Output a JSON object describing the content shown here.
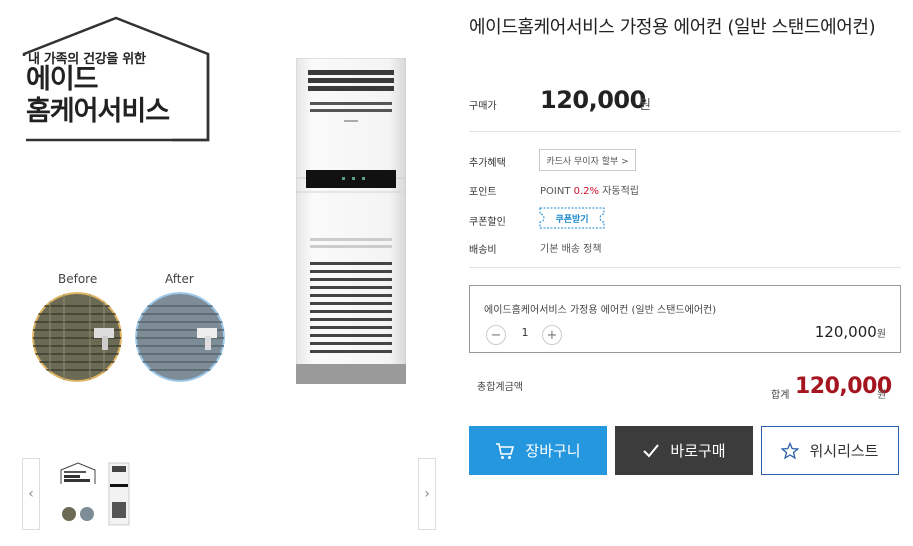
{
  "gallery": {
    "brand_line1": "내 가족의 건강을 위한",
    "brand_line2": "에이드",
    "brand_line3": "홈케어서비스",
    "before_label": "Before",
    "after_label": "After",
    "prev_icon": "chevron-left-icon",
    "next_icon": "chevron-right-icon"
  },
  "product": {
    "title": "에이드홈케어서비스 가정용 에어컨 (일반 스탠드에어컨)",
    "price_label": "구매가",
    "price": "120,000",
    "currency": "원",
    "benefit_label": "추가혜택",
    "benefit_button": "카드사 무이자 할부 >",
    "point_label": "포인트",
    "point_prefix": "POINT ",
    "point_rate": "0.2%",
    "point_suffix": " 자동적립",
    "coupon_label": "쿠폰할인",
    "coupon_button": "쿠폰받기",
    "shipping_label": "배송비",
    "shipping_value": "기본 배송 정책"
  },
  "option": {
    "name": "에이드홈케어서비스 가정용 에어컨 (일반 스탠드에어컨)",
    "minus": "−",
    "qty": "1",
    "plus": "+",
    "price": "120,000",
    "currency": "원"
  },
  "total": {
    "label": "총합계금액",
    "sum_label": "합계",
    "price": "120,000",
    "currency": "원"
  },
  "actions": {
    "cart": "장바구니",
    "buy": "바로구매",
    "wish": "위시리스트"
  },
  "colors": {
    "cart_blue": "#2597df",
    "buy_dark": "#3c3c3c",
    "price_red": "#a5151f",
    "coupon_blue": "#1a88d0"
  }
}
